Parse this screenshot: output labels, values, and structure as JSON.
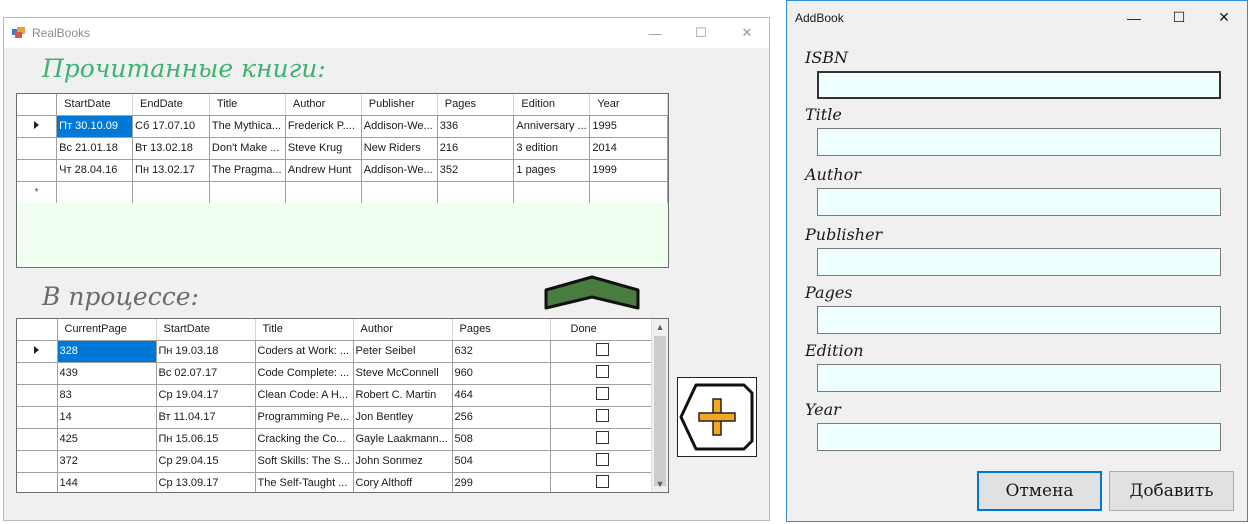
{
  "main_window": {
    "title": "RealBooks",
    "controls": {
      "minimize": "—",
      "maximize": "☐",
      "close": "✕"
    }
  },
  "read_books": {
    "heading": "Прочитанные книги:",
    "columns": [
      "StartDate",
      "EndDate",
      "Title",
      "Author",
      "Publisher",
      "Pages",
      "Edition",
      "Year"
    ],
    "rows": [
      [
        "Пт 30.10.09",
        "Сб 17.07.10",
        "The Mythica...",
        "Frederick P....",
        "Addison-We...",
        "336",
        "Anniversary ...",
        "1995"
      ],
      [
        "Вс 21.01.18",
        "Вт 13.02.18",
        "Don't Make ...",
        "Steve Krug",
        "New Riders",
        "216",
        "3 edition",
        "2014"
      ],
      [
        "Чт 28.04.16",
        "Пн 13.02.17",
        "The Pragma...",
        "Andrew Hunt",
        "Addison-We...",
        "352",
        "1 pages",
        "1999"
      ]
    ],
    "new_row_marker": "*"
  },
  "in_progress": {
    "heading": "В процессе:",
    "columns": [
      "CurrentPage",
      "StartDate",
      "Title",
      "Author",
      "Pages",
      "Done"
    ],
    "rows": [
      [
        "328",
        "Пн 19.03.18",
        "Coders at Work: ...",
        "Peter Seibel",
        "632"
      ],
      [
        "439",
        "Вс 02.07.17",
        "Code Complete: ...",
        "Steve McConnell",
        "960"
      ],
      [
        "83",
        "Ср 19.04.17",
        "Clean Code: A H...",
        "Robert C. Martin",
        "464"
      ],
      [
        "14",
        "Вт 11.04.17",
        "Programming Pe...",
        "Jon Bentley",
        "256"
      ],
      [
        "425",
        "Пн 15.06.15",
        "Cracking the Co...",
        "Gayle Laakmann...",
        "508"
      ],
      [
        "372",
        "Ср 29.04.15",
        "Soft Skills: The S...",
        "John Sonmez",
        "504"
      ],
      [
        "144",
        "Ср 13.09.17",
        "The Self-Taught ...",
        "Cory Althoff",
        "299"
      ]
    ]
  },
  "icons": {
    "move_to_read": "chevron-up-icon",
    "add_book": "plus-icon",
    "app": "app-icon"
  },
  "colors": {
    "read_heading": "#3cb371",
    "read_grid_background": "#f0fff0",
    "selection": "#0078d7",
    "chevron_fill": "#4a7c3f",
    "plus_fill": "#f5a623",
    "input_background": "#f0ffff"
  },
  "dialog": {
    "title": "AddBook",
    "controls": {
      "minimize": "—",
      "maximize": "☐",
      "close": "✕"
    },
    "fields": [
      {
        "label": "ISBN",
        "value": ""
      },
      {
        "label": "Title",
        "value": ""
      },
      {
        "label": "Author",
        "value": ""
      },
      {
        "label": "Publisher",
        "value": ""
      },
      {
        "label": "Pages",
        "value": ""
      },
      {
        "label": "Edition",
        "value": ""
      },
      {
        "label": "Year",
        "value": ""
      }
    ],
    "cancel_label": "Отмена",
    "add_label": "Добавить"
  }
}
